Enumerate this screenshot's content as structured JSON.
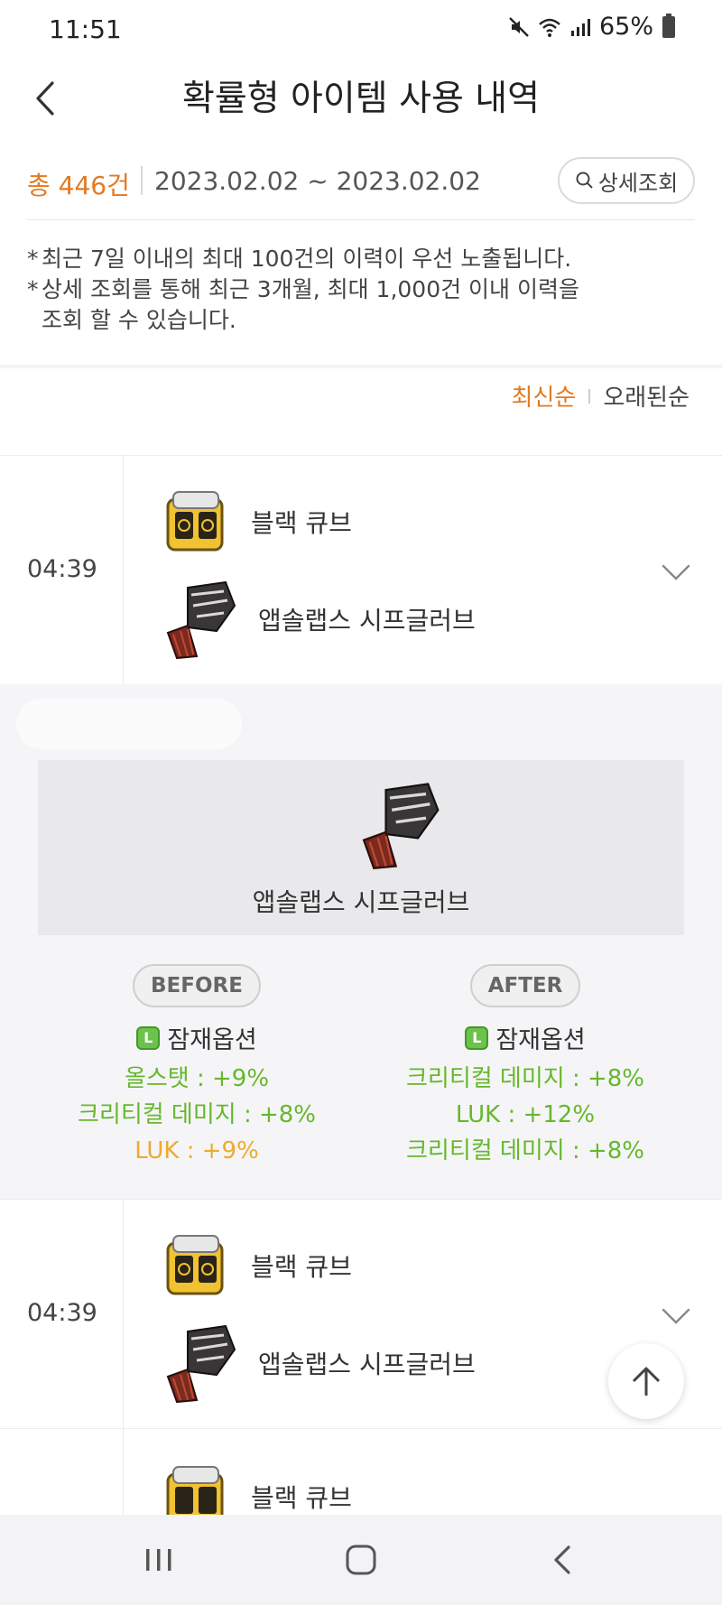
{
  "status": {
    "time": "11:51",
    "battery": "65%"
  },
  "header": {
    "title": "확률형 아이템 사용 내역"
  },
  "summary": {
    "count": "총 446건",
    "date_range": "2023.02.02 ~ 2023.02.02",
    "detail_button": "상세조회"
  },
  "notes": [
    "최근 7일 이내의 최대 100건의 이력이 우선 노출됩니다.",
    "상세 조회를 통해 최근 3개월, 최대 1,000건 이내 이력을",
    "조회 할 수 있습니다."
  ],
  "sort": {
    "active": "최신순",
    "inactive": "오래된순"
  },
  "records": [
    {
      "time": "04:39",
      "cube": "블랙 큐브",
      "item": "앱솔랩스 시프글러브"
    },
    {
      "time": "04:39",
      "cube": "블랙 큐브",
      "item": "앱솔랩스 시프글러브"
    },
    {
      "cube": "블랙 큐브"
    }
  ],
  "detail": {
    "item_name": "앱솔랩스 시프글러브",
    "before": {
      "label": "BEFORE",
      "potential_title": "잠재옵션",
      "options": [
        "올스탯 : +9%",
        "크리티컬 데미지 : +8%",
        "LUK : +9%"
      ]
    },
    "after": {
      "label": "AFTER",
      "potential_title": "잠재옵션",
      "options": [
        "크리티컬 데미지 : +8%",
        "LUK : +12%",
        "크리티컬 데미지 : +8%"
      ]
    }
  },
  "colors": {
    "accent_orange": "#e27a22",
    "option_green": "#66b82b",
    "option_yellow": "#eeaa2e"
  }
}
